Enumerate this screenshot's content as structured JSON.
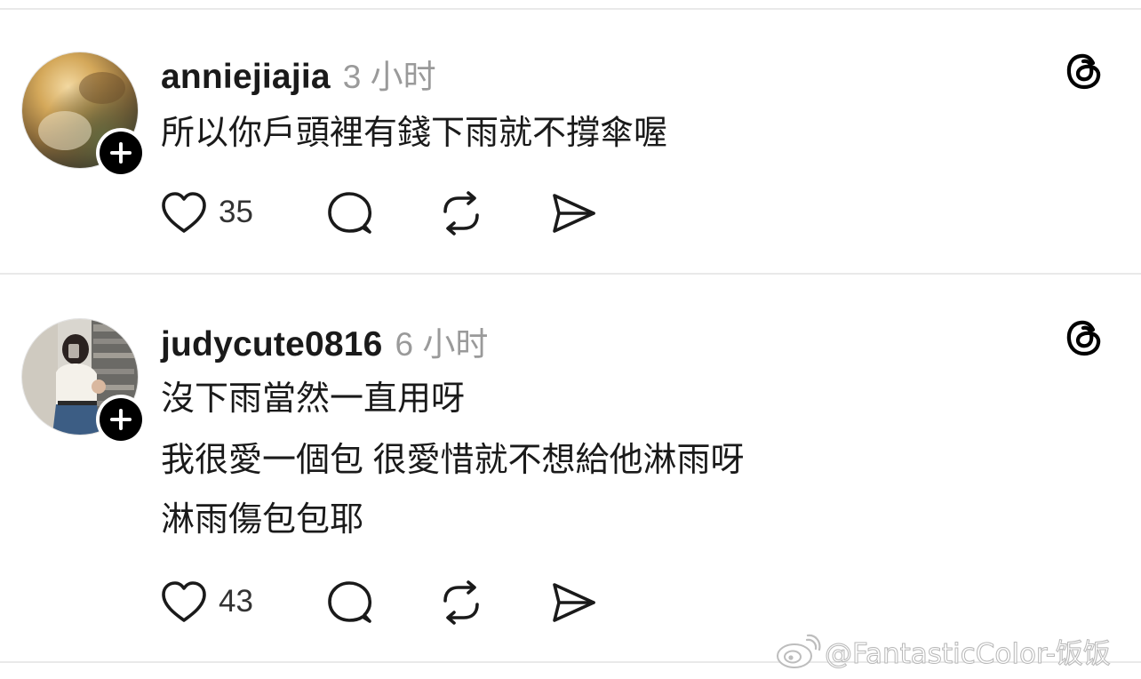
{
  "posts": [
    {
      "username": "anniejiajia",
      "time": "3 小时",
      "lines": [
        "所以你戶頭裡有錢下雨就不撐傘喔"
      ],
      "likes": "35",
      "avatar_icon": "blurred-photo-avatar"
    },
    {
      "username": "judycute0816",
      "time": "6 小时",
      "lines": [
        "沒下雨當然一直用呀",
        "我很愛一個包 很愛惜就不想給他淋雨呀",
        "淋雨傷包包耶"
      ],
      "likes": "43",
      "avatar_icon": "mirror-selfie-avatar"
    }
  ],
  "watermark": {
    "text": "@FantasticColor-饭饭",
    "icon": "weibo-logo-icon"
  },
  "icons": {
    "like": "heart-icon",
    "reply": "comment-bubble-icon",
    "repost": "repost-icon",
    "share": "send-icon",
    "app": "threads-icon",
    "follow": "plus-icon"
  }
}
